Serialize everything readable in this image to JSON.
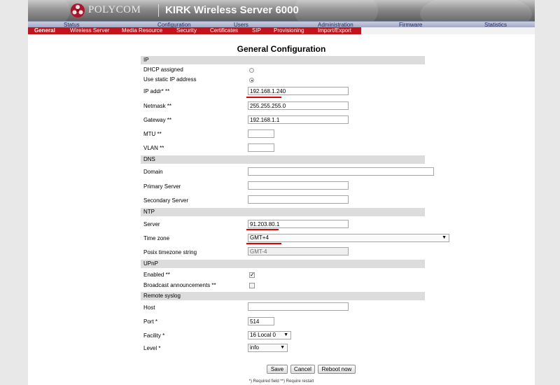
{
  "header": {
    "brand": "POLYCOM",
    "product": "KIRK Wireless Server 6000"
  },
  "main_nav": [
    "Status",
    "Configuration",
    "Users",
    "Administration",
    "Firmware",
    "Statistics"
  ],
  "sub_nav": [
    "General",
    "Wireless Server",
    "Media Resource",
    "Security",
    "Certificates",
    "SIP",
    "Provisioning",
    "Import/Export"
  ],
  "page_title": "General Configuration",
  "sections": {
    "ip": {
      "title": "IP",
      "dhcp_label": "DHCP assigned",
      "static_label": "Use static IP address",
      "ip_label": "IP addr* **",
      "ip_value": "192.168.1.240",
      "netmask_label": "Netmask **",
      "netmask_value": "255.255.255.0",
      "gateway_label": "Gateway **",
      "gateway_value": "192.168.1.1",
      "mtu_label": "MTU **",
      "mtu_value": "",
      "vlan_label": "VLAN **",
      "vlan_value": ""
    },
    "dns": {
      "title": "DNS",
      "domain_label": "Domain",
      "domain_value": "",
      "primary_label": "Primary Server",
      "primary_value": "",
      "secondary_label": "Secondary Server",
      "secondary_value": ""
    },
    "ntp": {
      "title": "NTP",
      "server_label": "Server",
      "server_value": "91.203.80.1",
      "timezone_label": "Time zone",
      "timezone_value": "GMT+4",
      "posix_label": "Posix timezone string",
      "posix_value": "GMT-4"
    },
    "upnp": {
      "title": "UPnP",
      "enabled_label": "Enabled **",
      "broadcast_label": "Broadcast announcements **"
    },
    "syslog": {
      "title": "Remote syslog",
      "host_label": "Host",
      "host_value": "",
      "port_label": "Port *",
      "port_value": "514",
      "facility_label": "Facility *",
      "facility_value": "16 Local 0",
      "level_label": "Level *",
      "level_value": "info"
    }
  },
  "buttons": {
    "save": "Save",
    "cancel": "Cancel",
    "reboot": "Reboot now"
  },
  "footnote": "*) Required field **) Require restart",
  "colors": {
    "subnav_bg": "#c4131b",
    "mainnav_bg": "#b4b9d2",
    "section_bg": "#dcdcdc",
    "highlight_underline": "#e00000"
  }
}
